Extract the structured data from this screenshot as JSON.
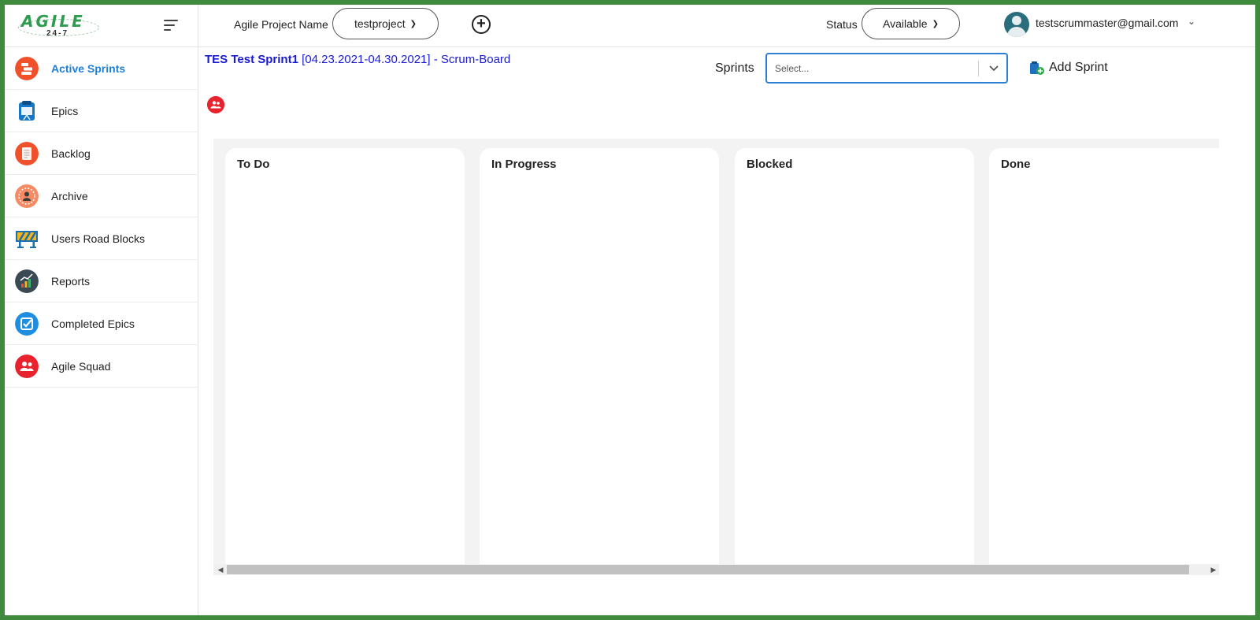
{
  "logo": {
    "text": "AGILE",
    "sub": "24-7"
  },
  "header": {
    "project_label": "Agile Project Name",
    "project_value": "testproject",
    "status_label": "Status",
    "status_value": "Available",
    "user_email": "testscrummaster@gmail.com"
  },
  "sidebar": {
    "items": [
      {
        "label": "Active Sprints",
        "icon": "active-sprints-icon",
        "active": true
      },
      {
        "label": "Epics",
        "icon": "epics-icon"
      },
      {
        "label": "Backlog",
        "icon": "backlog-icon"
      },
      {
        "label": "Archive",
        "icon": "archive-icon"
      },
      {
        "label": "Users Road Blocks",
        "icon": "road-blocks-icon"
      },
      {
        "label": "Reports",
        "icon": "reports-icon"
      },
      {
        "label": "Completed Epics",
        "icon": "completed-epics-icon"
      },
      {
        "label": "Agile Squad",
        "icon": "agile-squad-icon"
      }
    ]
  },
  "main": {
    "title_bold": "TES Test Sprint1",
    "title_rest": " [04.23.2021-04.30.2021] - Scrum-Board",
    "sprints_label": "Sprints",
    "sprints_placeholder": "Select...",
    "add_sprint_label": "Add Sprint"
  },
  "board": {
    "columns": [
      {
        "title": "To Do"
      },
      {
        "title": "In Progress"
      },
      {
        "title": "Blocked"
      },
      {
        "title": "Done"
      }
    ]
  },
  "colors": {
    "frame": "#3f8a3c",
    "accent_blue": "#1e7fd6",
    "title_blue": "#1a1ad2",
    "logo_green": "#2e9b4e"
  }
}
